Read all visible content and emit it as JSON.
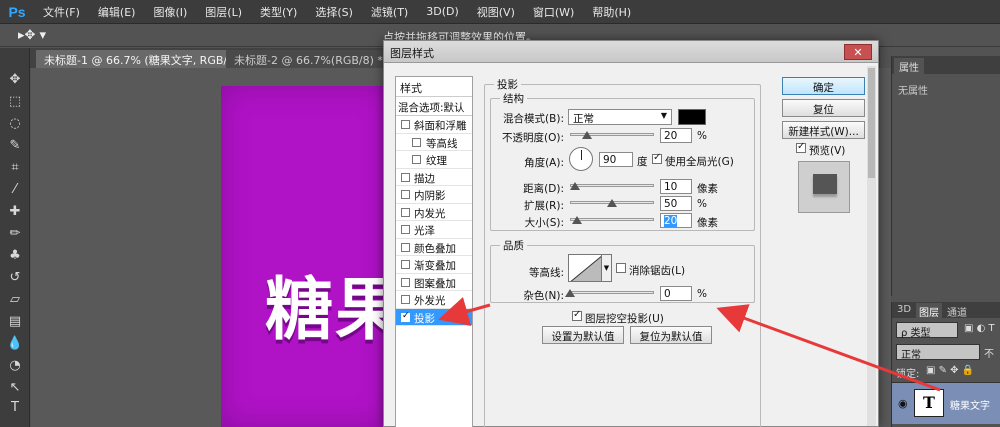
{
  "app": {
    "logo": "Ps"
  },
  "menu": [
    "文件(F)",
    "编辑(E)",
    "图像(I)",
    "图层(L)",
    "类型(Y)",
    "选择(S)",
    "滤镜(T)",
    "3D(D)",
    "视图(V)",
    "窗口(W)",
    "帮助(H)"
  ],
  "options_bar": {
    "hint": "点按并拖移可调整效果的位置。"
  },
  "tabs": [
    {
      "label": "未标题-1 @ 66.7% (糖果文字, RGB/8) *",
      "close": "×"
    },
    {
      "label": "未标题-2 @ 66.7%(RGB/8) *",
      "close": "×"
    }
  ],
  "canvas": {
    "text": "糖果",
    "bg_color": "#b012c6"
  },
  "dialog": {
    "title": "图层样式",
    "close": "✕",
    "style_list": {
      "header": "样式",
      "blend": "混合选项:默认",
      "items": [
        "斜面和浮雕",
        "等高线",
        "纹理",
        "描边",
        "内阴影",
        "内发光",
        "光泽",
        "颜色叠加",
        "渐变叠加",
        "图案叠加",
        "外发光",
        "投影"
      ],
      "active": "投影"
    },
    "section_title": "投影",
    "structure": {
      "title": "结构",
      "blend_mode_label": "混合模式(B):",
      "blend_mode_value": "正常",
      "blend_color": "#000000",
      "opacity_label": "不透明度(O):",
      "opacity_value": "20",
      "opacity_unit": "%",
      "angle_label": "角度(A):",
      "angle_value": "90",
      "angle_unit": "度",
      "global_light_label": "使用全局光(G)",
      "global_light_checked": true,
      "distance_label": "距离(D):",
      "distance_value": "10",
      "distance_unit": "像素",
      "spread_label": "扩展(R):",
      "spread_value": "50",
      "spread_unit": "%",
      "size_label": "大小(S):",
      "size_value": "20",
      "size_unit": "像素"
    },
    "quality": {
      "title": "品质",
      "contour_label": "等高线:",
      "antialias_label": "消除锯齿(L)",
      "antialias_checked": false,
      "noise_label": "杂色(N):",
      "noise_value": "0",
      "noise_unit": "%"
    },
    "knockout_label": "图层挖空投影(U)",
    "knockout_checked": true,
    "set_default": "设置为默认值",
    "reset_default": "复位为默认值",
    "buttons": {
      "ok": "确定",
      "reset": "复位",
      "new_style": "新建样式(W)...",
      "preview": "预览(V)"
    },
    "preview_checked": true
  },
  "properties_panel": {
    "tab": "属性",
    "text": "无属性"
  },
  "layers_panel": {
    "tabs": [
      "3D",
      "图层",
      "通道"
    ],
    "active_tab": "图层",
    "filter": "ρ 类型",
    "blend": "正常",
    "opacity_prefix": "不",
    "lock_label": "锁定:",
    "layer_name": "糖果文字",
    "layer_thumb": "T"
  },
  "colors": {
    "accent_arrow": "#e8393a",
    "selection": "#3399ff"
  }
}
